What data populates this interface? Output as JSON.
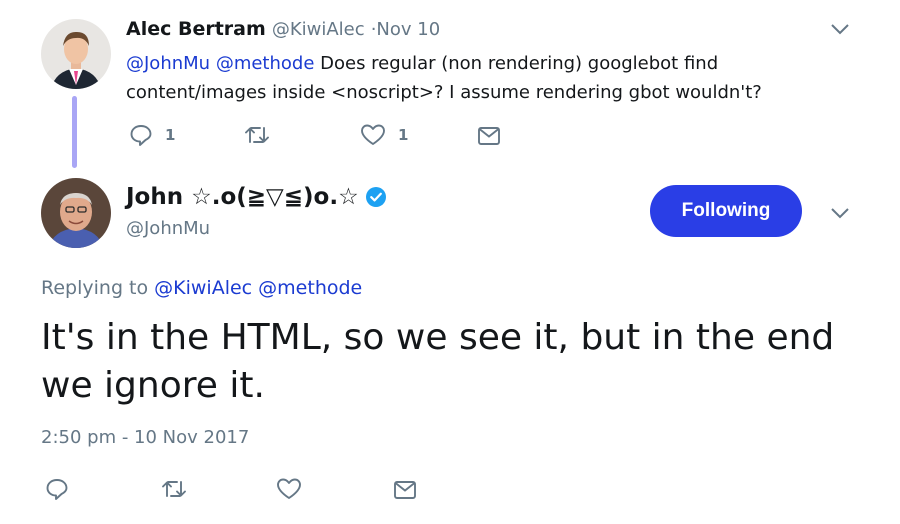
{
  "reply_tweet": {
    "author_name": "Alec Bertram",
    "author_handle": "@KiwiAlec",
    "date": "·Nov 10",
    "mention1": "@JohnMu",
    "mention2": "@methode",
    "text": " Does regular (non rendering) googlebot find content/images inside <noscript>? I assume rendering gbot wouldn't?",
    "reply_count": "1",
    "like_count": "1"
  },
  "main_tweet": {
    "author_name": "John ☆.o(≧▽≦)o.☆",
    "author_handle": "@JohnMu",
    "follow_label": "Following",
    "replying_prefix": "Replying to ",
    "replying_to1": "@KiwiAlec",
    "replying_to2": "@methode",
    "text": "It's in the HTML, so we see it, but in the end we ignore it.",
    "timestamp": "2:50 pm - 10 Nov 2017"
  },
  "colors": {
    "accent": "#2a3ee6",
    "link": "#1b3bd1",
    "muted": "#657786",
    "thread_line": "#a9a6f5",
    "verified": "#1da1f2"
  },
  "icons": [
    "reply-icon",
    "retweet-icon",
    "like-icon",
    "direct-message-icon",
    "chevron-down-icon",
    "verified-badge-icon"
  ]
}
